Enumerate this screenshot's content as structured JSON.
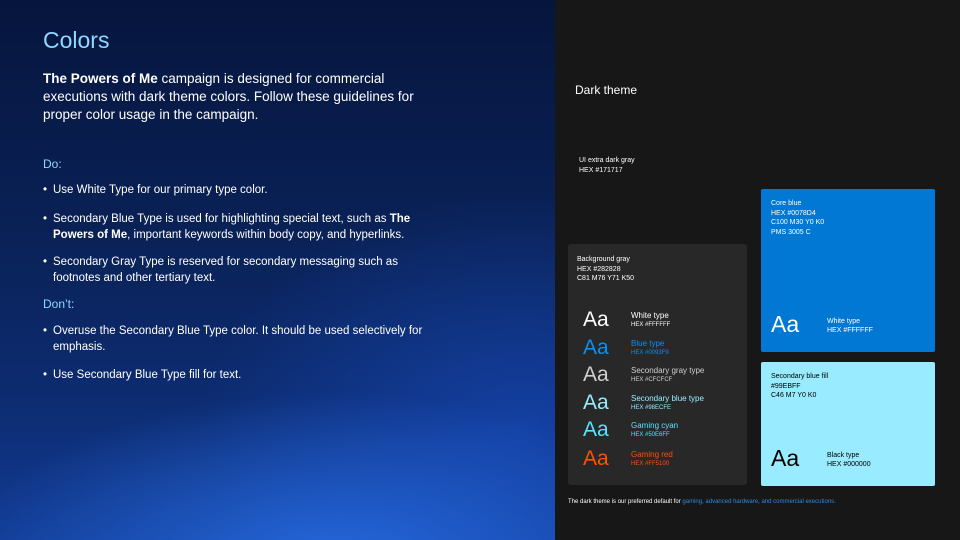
{
  "title": "Colors",
  "intro": {
    "bold": "The Powers of Me",
    "rest": " campaign is designed for commercial executions with dark theme colors. Follow these guidelines for proper color usage in the campaign."
  },
  "do": {
    "heading": "Do:",
    "item1": "Use White Type for our primary type color.",
    "item2_pre": "Secondary Blue Type is used for highlighting special text, such as ",
    "item2_bold": "The Powers of Me",
    "item2_post": ", important keywords within body copy, and hyperlinks.",
    "item3": "Secondary Gray Type is reserved for secondary messaging such as footnotes and other tertiary text."
  },
  "dont": {
    "heading": "Don’t:",
    "item1": "Overuse the Secondary Blue Type color. It should be used selectively for emphasis.",
    "item2": "Use Secondary Blue Type fill for text."
  },
  "panel": {
    "heading": "Dark theme",
    "ui_extra_dark": {
      "name": "UI extra dark gray",
      "hex": "HEX #171717"
    },
    "background_gray": {
      "label": "Background gray\nHEX #282828\nC81 M76 Y71 K50",
      "color": "#282828"
    },
    "swatches": [
      {
        "aa": "Aa",
        "name": "White type",
        "hex": "HEX #FFFFFF",
        "color": "#FFFFFF"
      },
      {
        "aa": "Aa",
        "name": "Blue type",
        "hex": "HEX #0093F9",
        "color": "#0093F9"
      },
      {
        "aa": "Aa",
        "name": "Secondary gray type",
        "hex": "HEX #CFCFCF",
        "color": "#CFCFCF"
      },
      {
        "aa": "Aa",
        "name": "Secondary blue type",
        "hex": "HEX #98ECFE",
        "color": "#98ECFE"
      },
      {
        "aa": "Aa",
        "name": "Gaming cyan",
        "hex": "HEX #50E6FF",
        "color": "#50E6FF"
      },
      {
        "aa": "Aa",
        "name": "Gaming red",
        "hex": "HEX #FF5100",
        "color": "#FF5100"
      }
    ],
    "core_blue": {
      "label": "Core blue\nHEX #0078D4\nC100 M30 Y0 K0\nPMS 3005 C",
      "color": "#0078D4",
      "aa": "Aa",
      "type_name": "White type",
      "type_hex": "HEX #FFFFFF"
    },
    "secondary_fill": {
      "label": "Secondary blue fill\n#99EBFF\nC46 M7 Y0 K0",
      "color": "#99EBFF",
      "aa": "Aa",
      "type_name": "Black type",
      "type_hex": "HEX #000000"
    },
    "footnote": {
      "pre": "The dark theme is our preferred default for ",
      "highlight": "gaming, advanced hardware, and commercial executions."
    }
  }
}
